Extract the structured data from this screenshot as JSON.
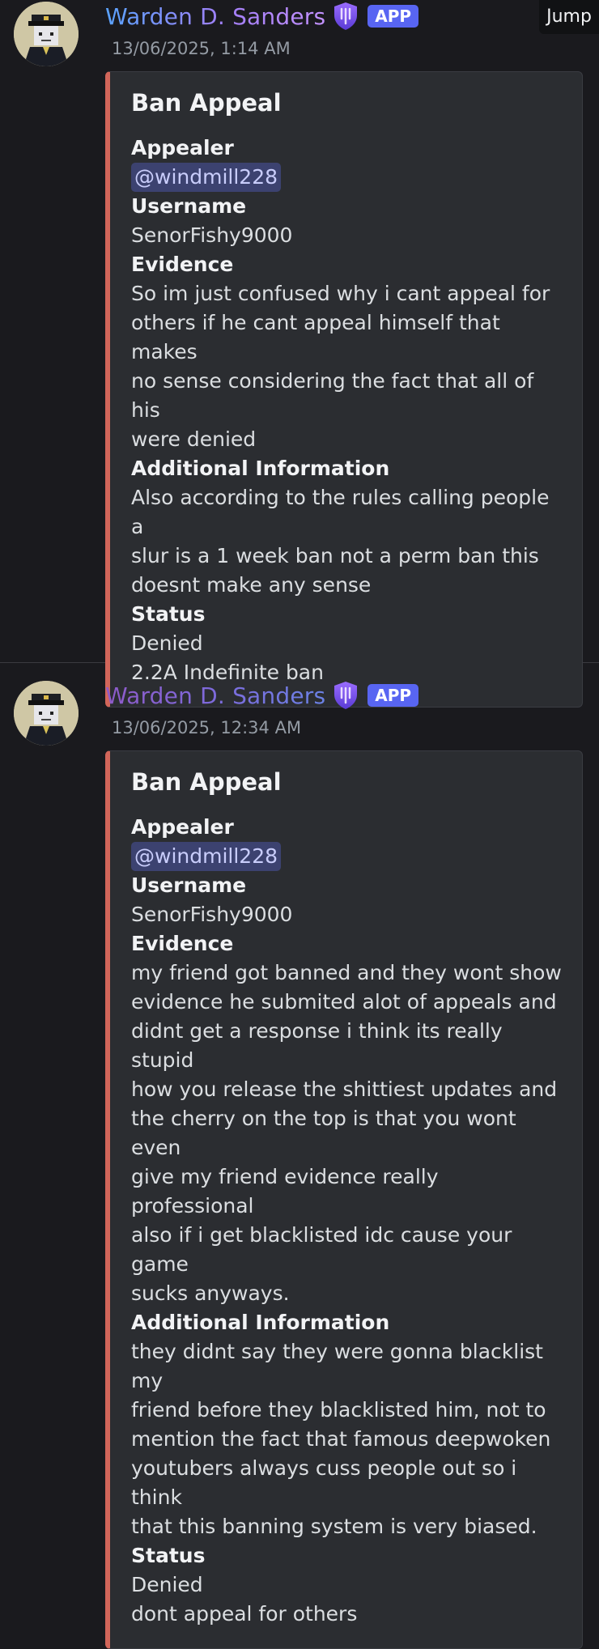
{
  "ui": {
    "jump_label": "Jump"
  },
  "messages": [
    {
      "author": "Warden D. Sanders",
      "badge": "APP",
      "timestamp": "13/06/2025, 1:14 AM",
      "embed": {
        "title": "Ban Appeal",
        "appealer_label": "Appealer",
        "appealer_mention": "@windmill228",
        "username_label": "Username",
        "username": "SenorFishy9000",
        "evidence_label": "Evidence",
        "evidence": "So im just confused why i cant appeal for\nothers if he cant appeal himself that makes\nno sense considering the fact that all of his\nwere denied",
        "additional_label": "Additional Information",
        "additional": "Also according to the rules calling people a\nslur is a 1 week ban not a perm ban this\ndoesnt make any sense",
        "status_label": "Status",
        "status": "Denied",
        "reason": "2.2A Indefinite ban"
      }
    },
    {
      "author": "Warden D. Sanders",
      "badge": "APP",
      "timestamp": "13/06/2025, 12:34 AM",
      "embed": {
        "title": "Ban Appeal",
        "appealer_label": "Appealer",
        "appealer_mention": "@windmill228",
        "username_label": "Username",
        "username": "SenorFishy9000",
        "evidence_label": "Evidence",
        "evidence": "my friend got banned and they wont show\nevidence he submited alot of appeals and\ndidnt get a response i think its really stupid\nhow you release the shittiest updates and\nthe cherry on the top is that you wont even\ngive my friend evidence really professional\nalso if i get blacklisted idc cause your game\nsucks anyways.",
        "additional_label": "Additional Information",
        "additional": "they didnt say they were gonna blacklist my\nfriend before they blacklisted him, not to\nmention the fact that famous deepwoken\nyoutubers always cuss people out so i think\nthat this banning system is very biased.",
        "status_label": "Status",
        "status": "Denied",
        "reason": "dont appeal for others"
      }
    }
  ],
  "colors": {
    "background": "#1a1a1e",
    "embed_bg": "#2b2d31",
    "embed_accent": "#d2665a",
    "app_badge": "#5865f2",
    "mention_bg": "#3c4270"
  }
}
